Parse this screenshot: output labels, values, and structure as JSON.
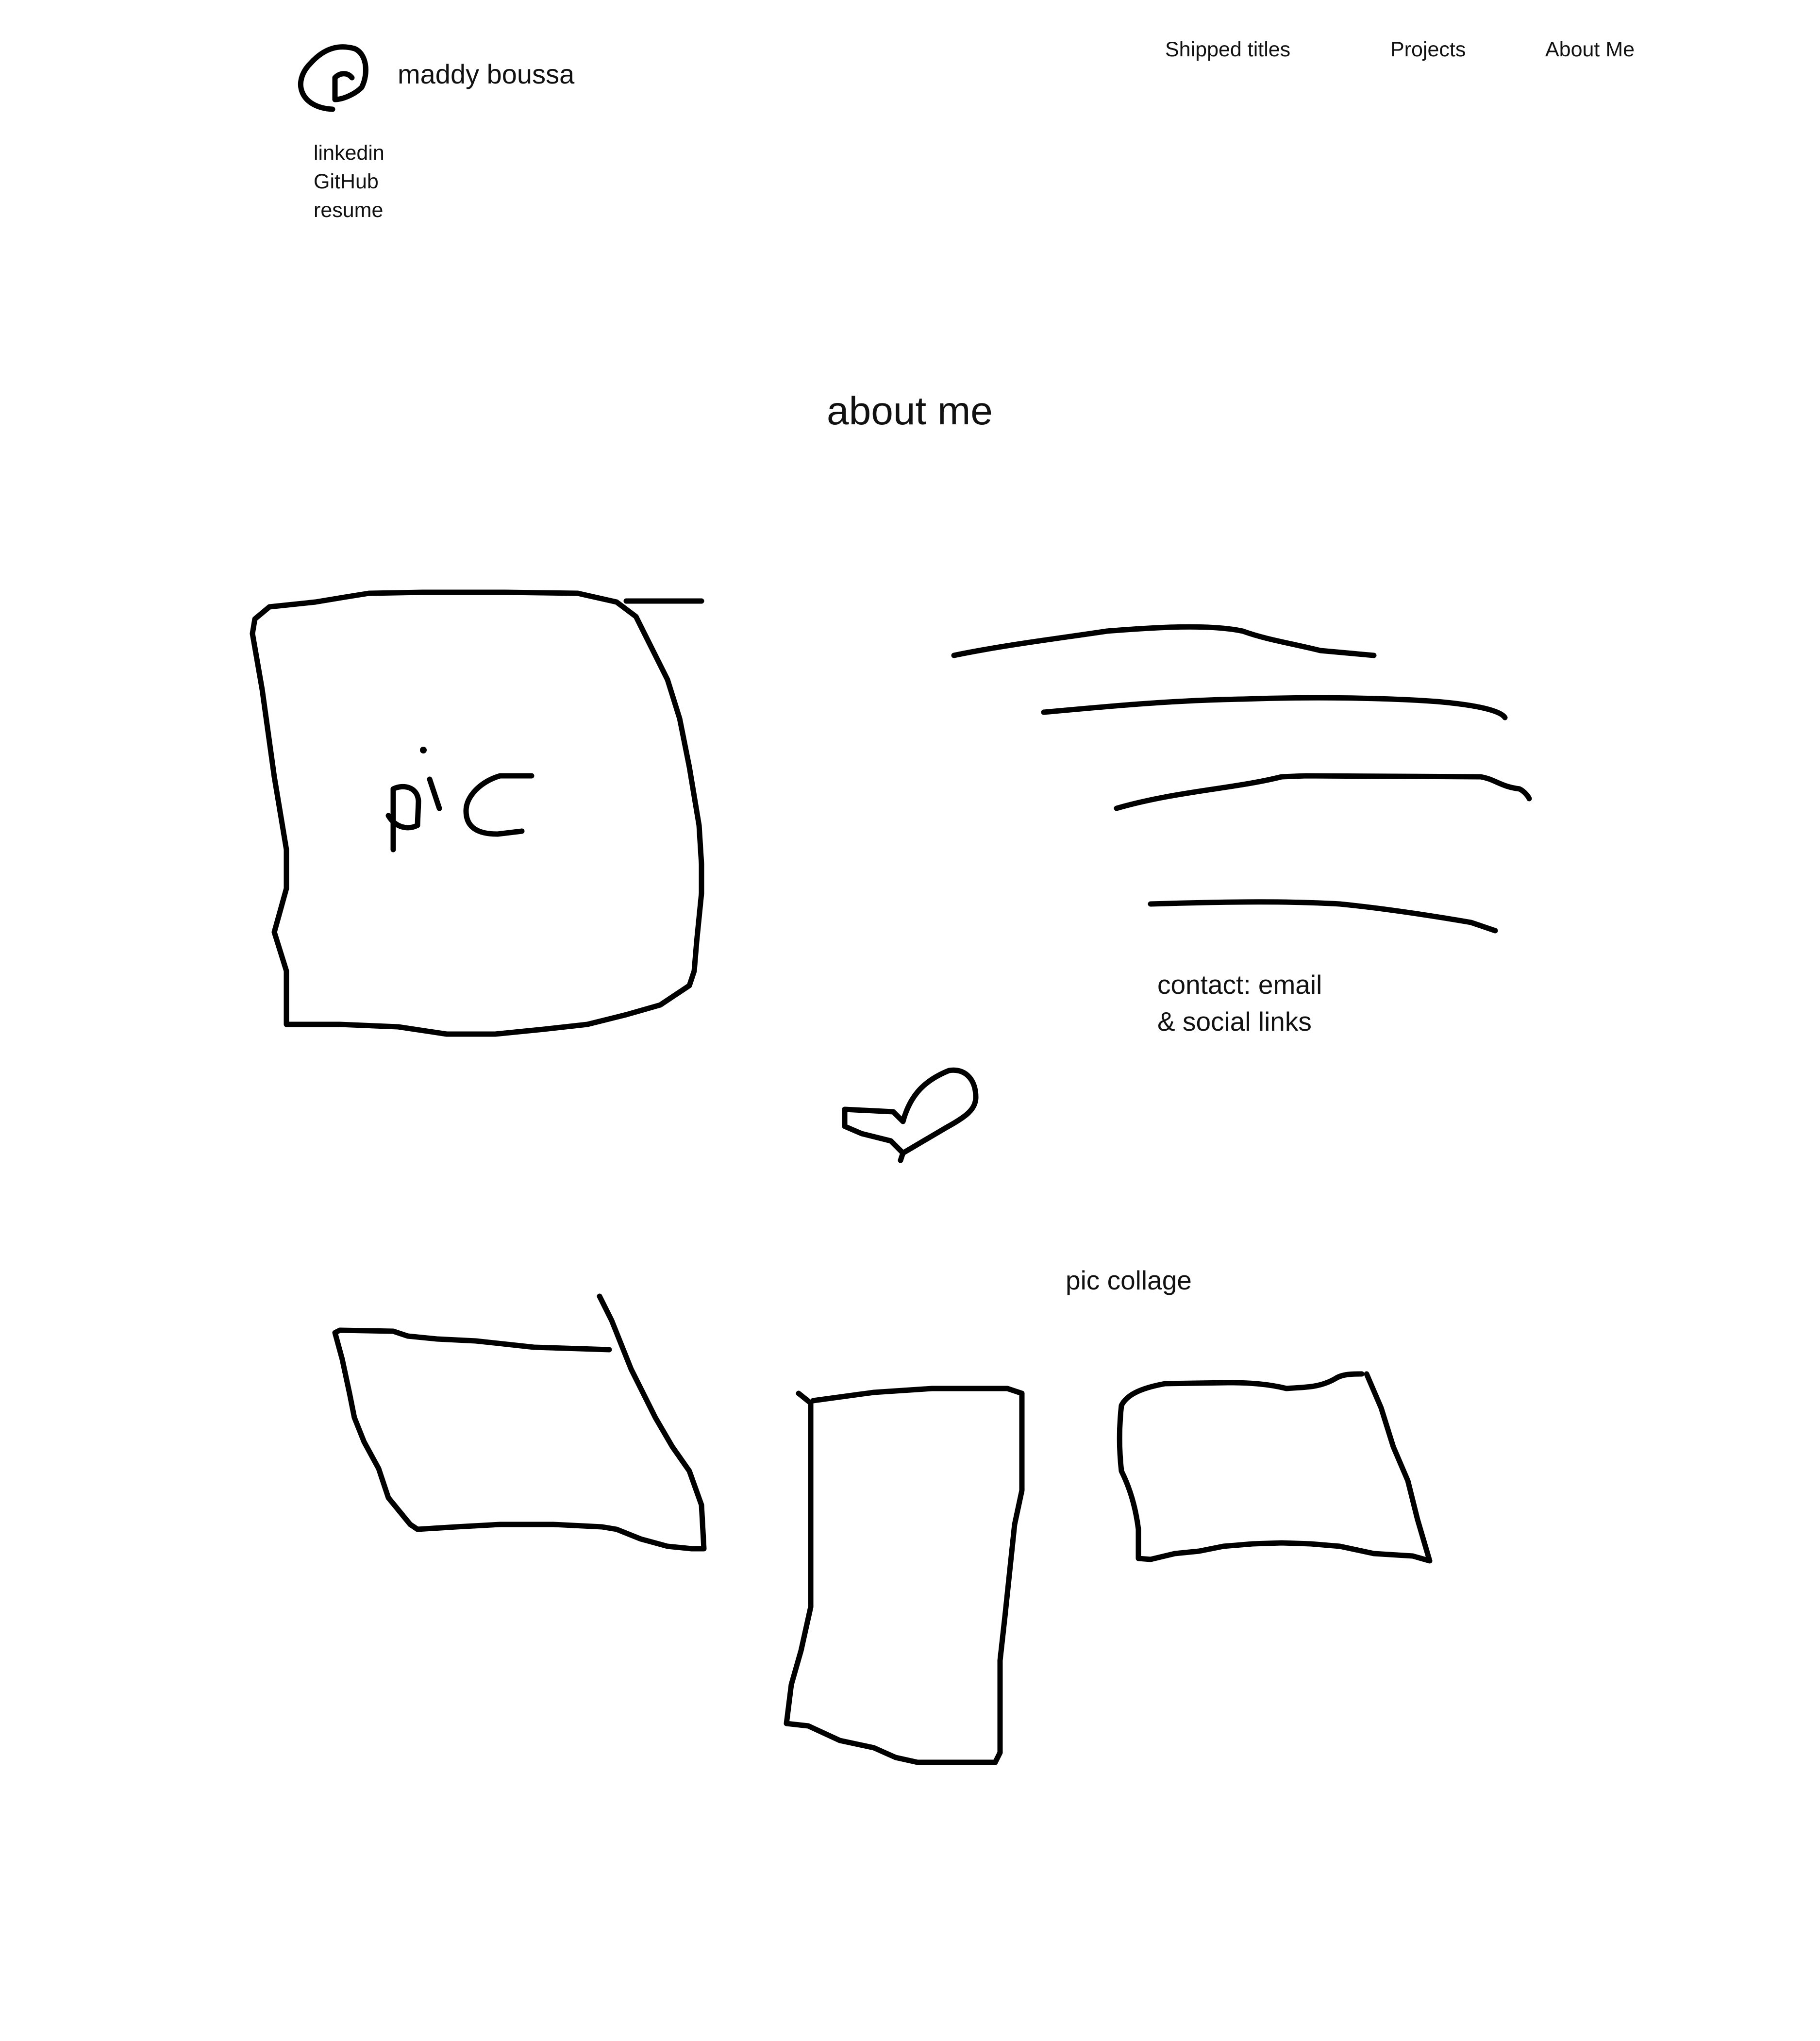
{
  "header": {
    "logo_icon": "at-sign-icon",
    "name": "maddy boussa",
    "links": [
      "linkedin",
      "GitHub",
      "resume"
    ]
  },
  "nav": {
    "items": [
      "Shipped titles",
      "Projects",
      "About Me"
    ]
  },
  "main": {
    "title": "about me",
    "profile_pic": {
      "label": "pic"
    },
    "bio_lines_icon": "text-lines-placeholder",
    "contact": {
      "line1": "contact: email",
      "line2": "& social links"
    },
    "divider_icon": "heart-icon",
    "collage": {
      "label": "pic collage"
    }
  }
}
